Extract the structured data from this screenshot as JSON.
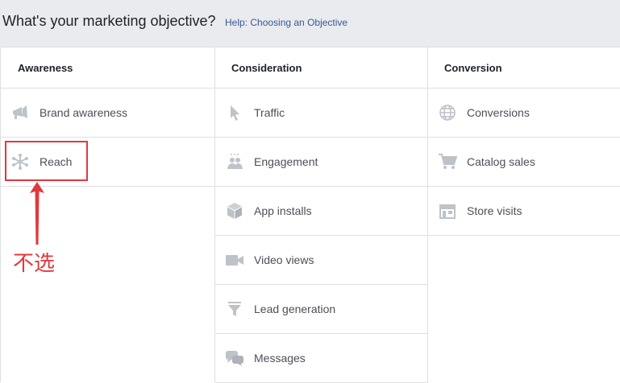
{
  "header": {
    "title": "What's your marketing objective?",
    "help_link": "Help: Choosing an Objective"
  },
  "columns": [
    {
      "title": "Awareness",
      "items": [
        {
          "label": "Brand awareness",
          "icon": "megaphone-icon"
        },
        {
          "label": "Reach",
          "icon": "asterisk-icon"
        }
      ]
    },
    {
      "title": "Consideration",
      "items": [
        {
          "label": "Traffic",
          "icon": "cursor-icon"
        },
        {
          "label": "Engagement",
          "icon": "people-icon"
        },
        {
          "label": "App installs",
          "icon": "box-icon"
        },
        {
          "label": "Video views",
          "icon": "video-camera-icon"
        },
        {
          "label": "Lead generation",
          "icon": "funnel-icon"
        },
        {
          "label": "Messages",
          "icon": "chat-bubbles-icon"
        }
      ]
    },
    {
      "title": "Conversion",
      "items": [
        {
          "label": "Conversions",
          "icon": "globe-icon"
        },
        {
          "label": "Catalog sales",
          "icon": "cart-icon"
        },
        {
          "label": "Store visits",
          "icon": "store-icon"
        }
      ]
    }
  ],
  "annotation": {
    "text": "不选",
    "color": "#e0393e"
  },
  "colors": {
    "icon": "#bec3c9",
    "link": "#365899",
    "border": "#dddfe2",
    "header_bg": "#e9ebee"
  }
}
